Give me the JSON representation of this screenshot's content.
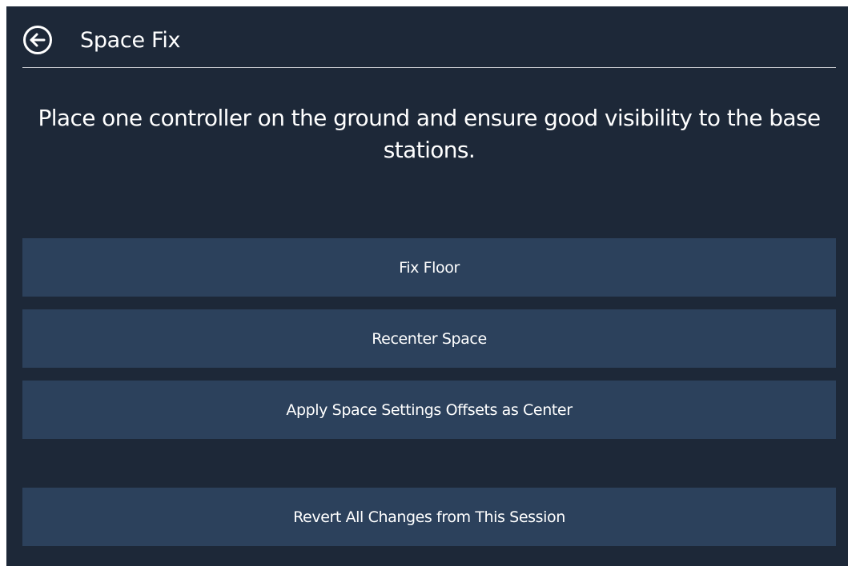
{
  "header": {
    "title": "Space Fix",
    "back_icon": "arrow-left-circle-icon"
  },
  "instruction": "Place one controller on the ground and ensure good visibility to the base stations.",
  "buttons": {
    "fix_floor": "Fix Floor",
    "recenter_space": "Recenter Space",
    "apply_offsets": "Apply Space Settings Offsets as Center",
    "revert_changes": "Revert All Changes from This Session"
  },
  "colors": {
    "background": "#1d2838",
    "button": "#2c415c",
    "text": "#ffffff",
    "divider": "#c9ccd1"
  }
}
